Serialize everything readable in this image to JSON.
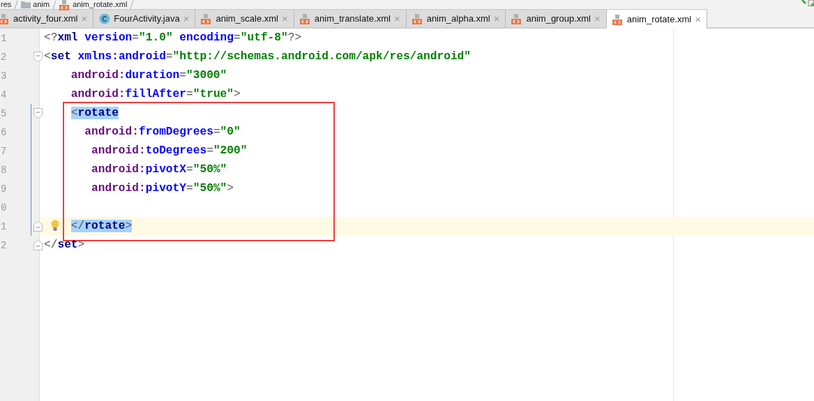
{
  "breadcrumb": [
    {
      "label": "res",
      "kind": "folder"
    },
    {
      "label": "anim",
      "kind": "folder"
    },
    {
      "label": "anim_rotate.xml",
      "kind": "xml"
    }
  ],
  "tabs": [
    {
      "label": "activity_four.xml",
      "kind": "xml",
      "selected": false
    },
    {
      "label": "FourActivity.java",
      "kind": "class",
      "selected": false
    },
    {
      "label": "anim_scale.xml",
      "kind": "xml",
      "selected": false
    },
    {
      "label": "anim_translate.xml",
      "kind": "xml",
      "selected": false
    },
    {
      "label": "anim_alpha.xml",
      "kind": "xml",
      "selected": false
    },
    {
      "label": "anim_group.xml",
      "kind": "xml",
      "selected": false
    },
    {
      "label": "anim_rotate.xml",
      "kind": "xml",
      "selected": true
    }
  ],
  "close_glyph": "×",
  "blocks": [
    {
      "kind": "plain",
      "lines": [
        {
          "number": "1",
          "kind": "plain",
          "current": false,
          "tokens": [
            {
              "text": "<?",
              "kind": "punct",
              "highlighted": false
            },
            {
              "text": "xml",
              "kind": "tag",
              "highlighted": false
            },
            {
              "text": " version",
              "kind": "attr",
              "highlighted": false
            },
            {
              "text": "=",
              "kind": "punct",
              "highlighted": false
            },
            {
              "text": "\"1.0\"",
              "kind": "value",
              "highlighted": false
            },
            {
              "text": " encoding",
              "kind": "attr",
              "highlighted": false
            },
            {
              "text": "=",
              "kind": "punct",
              "highlighted": false
            },
            {
              "text": "\"utf-8\"",
              "kind": "value",
              "highlighted": false
            },
            {
              "text": "?>",
              "kind": "punct",
              "highlighted": false
            }
          ]
        },
        {
          "number": "2",
          "kind": "fold-start",
          "current": false,
          "tokens": [
            {
              "text": "<",
              "kind": "punct",
              "highlighted": false
            },
            {
              "text": "set",
              "kind": "tag",
              "highlighted": false
            },
            {
              "text": " xmlns:android",
              "kind": "attr",
              "highlighted": false
            },
            {
              "text": "=",
              "kind": "punct",
              "highlighted": false
            },
            {
              "text": "\"http://schemas.android.com/apk/res/android\"",
              "kind": "value",
              "highlighted": false
            }
          ]
        },
        {
          "number": "3",
          "kind": "plain",
          "current": false,
          "tokens": [
            {
              "text": "    android:",
              "kind": "ns",
              "highlighted": false
            },
            {
              "text": "duration",
              "kind": "attr",
              "highlighted": false
            },
            {
              "text": "=",
              "kind": "punct",
              "highlighted": false
            },
            {
              "text": "\"3000\"",
              "kind": "value",
              "highlighted": false
            }
          ]
        },
        {
          "number": "4",
          "kind": "plain",
          "current": false,
          "tokens": [
            {
              "text": "    android:",
              "kind": "ns",
              "highlighted": false
            },
            {
              "text": "fillAfter",
              "kind": "attr",
              "highlighted": false
            },
            {
              "text": "=",
              "kind": "punct",
              "highlighted": false
            },
            {
              "text": "\"true\"",
              "kind": "value",
              "highlighted": false
            },
            {
              "text": ">",
              "kind": "punct",
              "highlighted": false
            }
          ]
        }
      ]
    },
    {
      "kind": "framed",
      "lines": [
        {
          "number": "5",
          "kind": "fold-start",
          "current": false,
          "tokens": [
            {
              "text": "    <",
              "kind": "punct",
              "highlighted": true
            },
            {
              "text": "rotate",
              "kind": "tag",
              "highlighted": true
            }
          ]
        },
        {
          "number": "6",
          "kind": "plain",
          "current": false,
          "tokens": [
            {
              "text": "      android:",
              "kind": "ns",
              "highlighted": false
            },
            {
              "text": "fromDegrees",
              "kind": "attr",
              "highlighted": false
            },
            {
              "text": "=",
              "kind": "punct",
              "highlighted": false
            },
            {
              "text": "\"0\"",
              "kind": "value",
              "highlighted": false
            }
          ]
        },
        {
          "number": "7",
          "kind": "plain",
          "current": false,
          "tokens": [
            {
              "text": "       android:",
              "kind": "ns",
              "highlighted": false
            },
            {
              "text": "toDegrees",
              "kind": "attr",
              "highlighted": false
            },
            {
              "text": "=",
              "kind": "punct",
              "highlighted": false
            },
            {
              "text": "\"200\"",
              "kind": "value",
              "highlighted": false
            }
          ]
        },
        {
          "number": "8",
          "kind": "plain",
          "current": false,
          "tokens": [
            {
              "text": "       android:",
              "kind": "ns",
              "highlighted": false
            },
            {
              "text": "pivotX",
              "kind": "attr",
              "highlighted": false
            },
            {
              "text": "=",
              "kind": "punct",
              "highlighted": false
            },
            {
              "text": "\"50%\"",
              "kind": "value",
              "highlighted": false
            }
          ]
        },
        {
          "number": "9",
          "kind": "plain",
          "current": false,
          "tokens": [
            {
              "text": "       android:",
              "kind": "ns",
              "highlighted": false
            },
            {
              "text": "pivotY",
              "kind": "attr",
              "highlighted": false
            },
            {
              "text": "=",
              "kind": "punct",
              "highlighted": false
            },
            {
              "text": "\"50%\"",
              "kind": "value",
              "highlighted": false
            },
            {
              "text": ">",
              "kind": "punct",
              "highlighted": false
            }
          ]
        },
        {
          "number": "0",
          "kind": "plain",
          "current": false
        },
        {
          "number": "1",
          "kind": "fold-end",
          "current": true,
          "tokens": [
            {
              "text": "    </",
              "kind": "punct",
              "highlighted": true
            },
            {
              "text": "rotate",
              "kind": "tag",
              "highlighted": true
            },
            {
              "text": ">",
              "kind": "punct",
              "highlighted": true
            }
          ]
        }
      ]
    },
    {
      "kind": "plain",
      "lines": [
        {
          "number": "2",
          "kind": "fold-end",
          "current": false,
          "tokens": [
            {
              "text": "</",
              "kind": "punct",
              "highlighted": false
            },
            {
              "text": "set",
              "kind": "tag",
              "highlighted": false
            },
            {
              "text": ">",
              "kind": "punct",
              "highlighted": false
            }
          ]
        }
      ]
    }
  ]
}
